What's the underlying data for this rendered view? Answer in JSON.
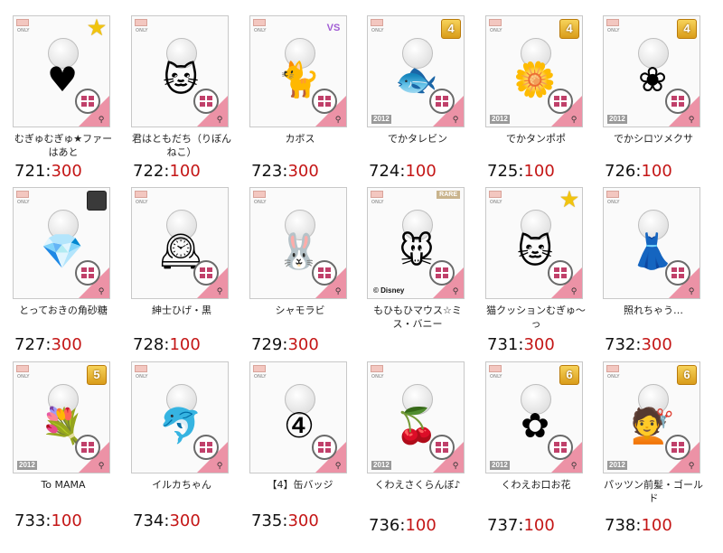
{
  "rows": [
    [
      {
        "name": "むぎゅむぎゅ★ファーはあと",
        "id": "721",
        "price": "300",
        "badge": "★",
        "badge_type": "star",
        "art": "♥"
      },
      {
        "name": "君はともだち（りぼんねこ）",
        "id": "722",
        "price": "100",
        "badge": "",
        "badge_type": "none",
        "art": "🐱"
      },
      {
        "name": "カボス",
        "id": "723",
        "price": "300",
        "badge": "VS",
        "badge_type": "vs",
        "art": "🐈"
      },
      {
        "name": "でかタレビン",
        "id": "724",
        "price": "100",
        "badge": "4",
        "badge_type": "num",
        "art": "🐟",
        "year": "2012"
      },
      {
        "name": "でかタンポポ",
        "id": "725",
        "price": "100",
        "badge": "4",
        "badge_type": "num",
        "art": "🌼",
        "year": "2012"
      },
      {
        "name": "でかシロツメクサ",
        "id": "726",
        "price": "100",
        "badge": "4",
        "badge_type": "num",
        "art": "❀",
        "year": "2012"
      }
    ],
    [
      {
        "name": "とっておきの角砂糖",
        "id": "727",
        "price": "300",
        "badge": "",
        "badge_type": "gray",
        "art": "💎"
      },
      {
        "name": "紳士ひげ・黒",
        "id": "728",
        "price": "100",
        "badge": "",
        "badge_type": "none",
        "art": "🕰"
      },
      {
        "name": "シャモラビ",
        "id": "729",
        "price": "300",
        "badge": "",
        "badge_type": "none",
        "art": "🐰"
      },
      {
        "name": "もひもひマウス☆ミス・バニー",
        "id": "730",
        "price": "",
        "badge": "",
        "badge_type": "rare",
        "rare": "RARE",
        "copyright": "© Disney",
        "art": "🐭"
      },
      {
        "name": "猫クッションむぎゅ〜っ",
        "id": "731",
        "price": "300",
        "badge": "★",
        "badge_type": "star",
        "art": "🐱"
      },
      {
        "name": "照れちゃう…",
        "id": "732",
        "price": "300",
        "badge": "",
        "badge_type": "none",
        "art": "👗"
      }
    ],
    [
      {
        "name": "To MAMA",
        "id": "733",
        "price": "100",
        "badge": "5",
        "badge_type": "num",
        "art": "💐",
        "year": "2012"
      },
      {
        "name": "イルカちゃん",
        "id": "734",
        "price": "300",
        "badge": "",
        "badge_type": "none",
        "art": "🐬"
      },
      {
        "name": "【4】缶バッジ",
        "id": "735",
        "price": "300",
        "badge": "",
        "badge_type": "none",
        "art": "④"
      },
      {
        "name": "くわえさくらんぼ♪",
        "id": "736",
        "price": "100",
        "badge": "",
        "badge_type": "none",
        "art": "🍒",
        "year": "2012"
      },
      {
        "name": "くわえお口お花",
        "id": "737",
        "price": "100",
        "badge": "6",
        "badge_type": "num",
        "art": "✿",
        "year": "2012"
      },
      {
        "name": "パッツン前髪・ゴールド",
        "id": "738",
        "price": "100",
        "badge": "6",
        "badge_type": "num",
        "art": "💇",
        "year": "2012"
      }
    ]
  ],
  "only_label": "ONLY",
  "separator": ":"
}
